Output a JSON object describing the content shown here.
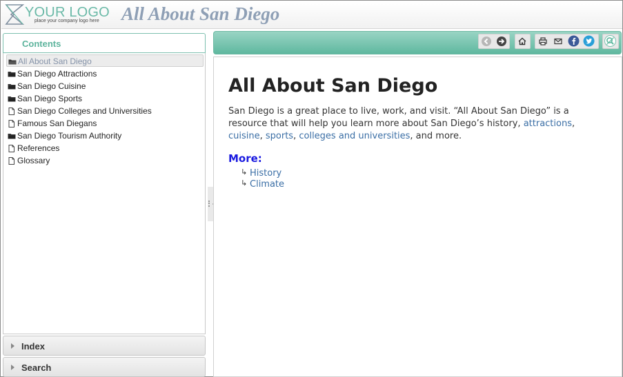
{
  "header": {
    "logo_text": "YOUR LOGO",
    "logo_tagline": "place your company logo here",
    "site_title": "All About San Diego"
  },
  "sidebar": {
    "contents_tab": "Contents",
    "toc": [
      {
        "label": "All About San Diego",
        "icon": "open-book-icon",
        "selected": true
      },
      {
        "label": "San Diego Attractions",
        "icon": "book-icon"
      },
      {
        "label": "San Diego Cuisine",
        "icon": "book-icon"
      },
      {
        "label": "San Diego Sports",
        "icon": "book-icon"
      },
      {
        "label": "San Diego Colleges and Universities",
        "icon": "page-icon"
      },
      {
        "label": "Famous San Diegans",
        "icon": "page-icon"
      },
      {
        "label": "San Diego Tourism Authority",
        "icon": "book-icon"
      },
      {
        "label": "References",
        "icon": "page-icon"
      },
      {
        "label": "Glossary",
        "icon": "page-icon"
      }
    ],
    "index_label": "Index",
    "search_label": "Search"
  },
  "toolbar": {
    "buttons": [
      "back-icon",
      "forward-icon",
      "home-icon",
      "print-icon",
      "email-icon",
      "facebook-icon",
      "twitter-icon",
      "search-highlight-icon"
    ]
  },
  "main": {
    "title": "All About San Diego",
    "para_1": "San Diego is a great place to live, work, and visit. “All About San Diego” is a resource that will help you learn more about San Diego’s history, ",
    "link_attractions": "attractions",
    "sep_1": ", ",
    "link_cuisine": "cuisine",
    "sep_2": ", ",
    "link_sports": "sports",
    "sep_3": ", ",
    "link_colleges": "colleges and universities",
    "para_end": ", and more.",
    "more_heading": "More:",
    "more_links": [
      "History",
      "Climate"
    ]
  },
  "colors": {
    "accent": "#5fb89f",
    "link": "#3a6ea5",
    "more_heading": "#1a1ae0",
    "site_title": "#8e9fb5"
  }
}
